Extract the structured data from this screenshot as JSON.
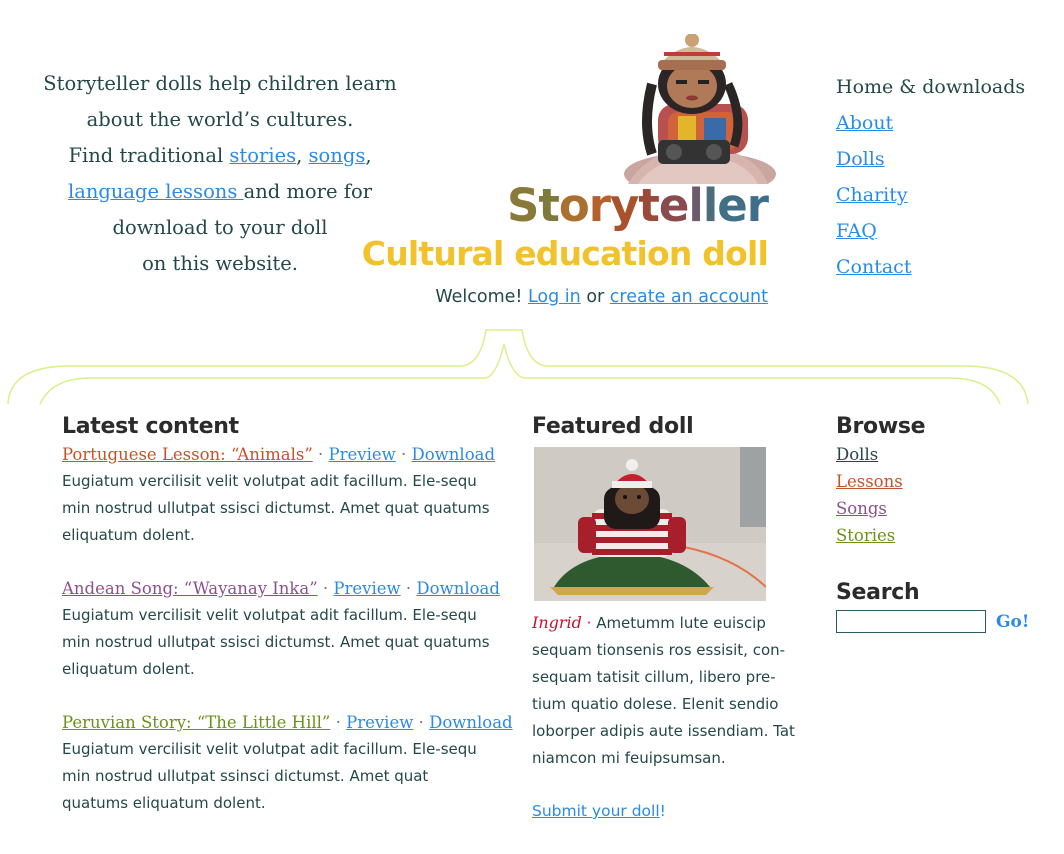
{
  "intro": {
    "line1": "Storyteller dolls help children learn",
    "line2": "about the world’s cultures.",
    "line3_pre": "Find traditional ",
    "link_stories": "stories",
    "comma1": ", ",
    "link_songs": "songs",
    "comma2": ",",
    "link_lessons": "language lessons ",
    "line4_post": "and more for",
    "line5": "download to your doll",
    "line6": "on this website."
  },
  "logo": {
    "title": "Storyteller",
    "subtitle": "Cultural education doll",
    "title_colors": [
      "#8a7a3a",
      "#7d7a3c",
      "#a9702f",
      "#b4612c",
      "#a8532d",
      "#9a4a38",
      "#8a4b4e",
      "#6f5a6b",
      "#4e6d7c",
      "#406f86",
      "#3e6e8c"
    ],
    "subtitle_color": "#f2c22b"
  },
  "welcome": {
    "text": "Welcome! ",
    "login": "Log in",
    "or": " or ",
    "create": "create an account"
  },
  "topnav": {
    "home": "Home & downloads",
    "about": "About",
    "dolls": "Dolls",
    "charity": "Charity",
    "faq": "FAQ",
    "contact": "Contact"
  },
  "latest": {
    "heading": "Latest content",
    "entries": [
      {
        "title": "Portuguese Lesson: “Animals”",
        "color": "#c7522a",
        "sep": " · ",
        "preview": "Preview",
        "download": "Download",
        "body": "Eugiatum vercilisit velit volutpat adit facillum. Ele-sequ min nostrud ullutpat ssisci dictumst. Amet quat quatums eliquatum dolent."
      },
      {
        "title": "Andean Song: “Wayanay Inka”",
        "color": "#8e4f8e",
        "sep": " · ",
        "preview": "Preview",
        "download": "Download",
        "body": "Eugiatum vercilisit velit volutpat adit facillum. Ele-sequ min nostrud ullutpat ssisci dictumst. Amet quat quatums eliquatum dolent."
      },
      {
        "title": "Peruvian Story: “The Little Hill”",
        "color": "#6a9216",
        "sep": " · ",
        "preview": "Preview",
        "download": "Download",
        "body": "Eugiatum vercilisit velit volutpat adit facillum. Ele-sequ min nostrud ullutpat ssinsci dictumst. Amet quat quatums eliquatum dolent."
      }
    ]
  },
  "featured": {
    "heading": "Featured doll",
    "name": "Ingrid",
    "sep": " · ",
    "text": "Ametumm lute euiscip sequam tionsenis ros essisit, con-sequam tatisit cillum, libero pre-tium quatio dolese. Elenit sendio loborper adipis aute issendiam. Tat niamcon mi feuipsumsan.",
    "submit_link": "Submit your doll",
    "submit_bang": "!"
  },
  "browse": {
    "heading": "Browse",
    "items": [
      {
        "label": "Dolls",
        "color": "#244848"
      },
      {
        "label": "Lessons",
        "color": "#c7522a"
      },
      {
        "label": "Songs",
        "color": "#8e4f8e"
      },
      {
        "label": "Stories",
        "color": "#6a9216"
      }
    ]
  },
  "search": {
    "heading": "Search",
    "value": "",
    "go": "Go!"
  },
  "colors": {
    "text": "#244848",
    "link": "#2a8be6",
    "brace": "#d9f08a",
    "heading": "#2b2b2b"
  }
}
